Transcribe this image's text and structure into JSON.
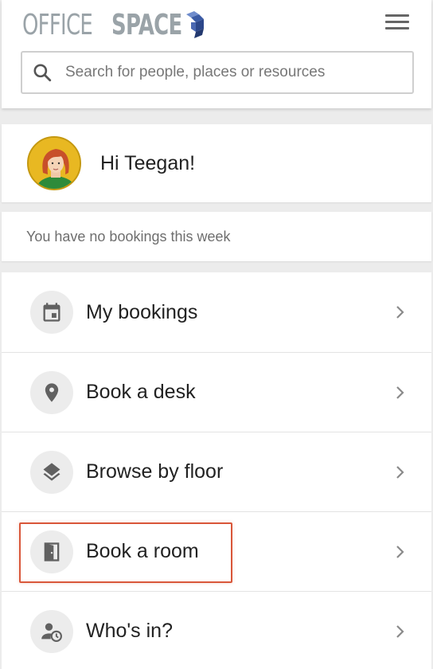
{
  "header": {
    "logo_light": "OFFICE",
    "logo_bold": "SPACE",
    "menu_icon": "hamburger-menu-icon"
  },
  "search": {
    "placeholder": "Search for people, places or resources",
    "value": "",
    "icon": "search-icon"
  },
  "greeting": {
    "text": "Hi Teegan!",
    "avatar": "avatar-illustration"
  },
  "notice": {
    "text": "You have no bookings this week"
  },
  "menu": {
    "items": [
      {
        "label": "My bookings",
        "icon": "calendar-icon"
      },
      {
        "label": "Book a desk",
        "icon": "location-pin-icon"
      },
      {
        "label": "Browse by floor",
        "icon": "layers-icon"
      },
      {
        "label": "Book a room",
        "icon": "door-icon",
        "highlighted": true
      },
      {
        "label": "Who's in?",
        "icon": "person-clock-icon"
      }
    ]
  },
  "colors": {
    "logo_gray": "#9aa3a8",
    "logo_blue": "#3b5ba5",
    "icon_gray": "#616161",
    "highlight_border": "#d9573a"
  }
}
